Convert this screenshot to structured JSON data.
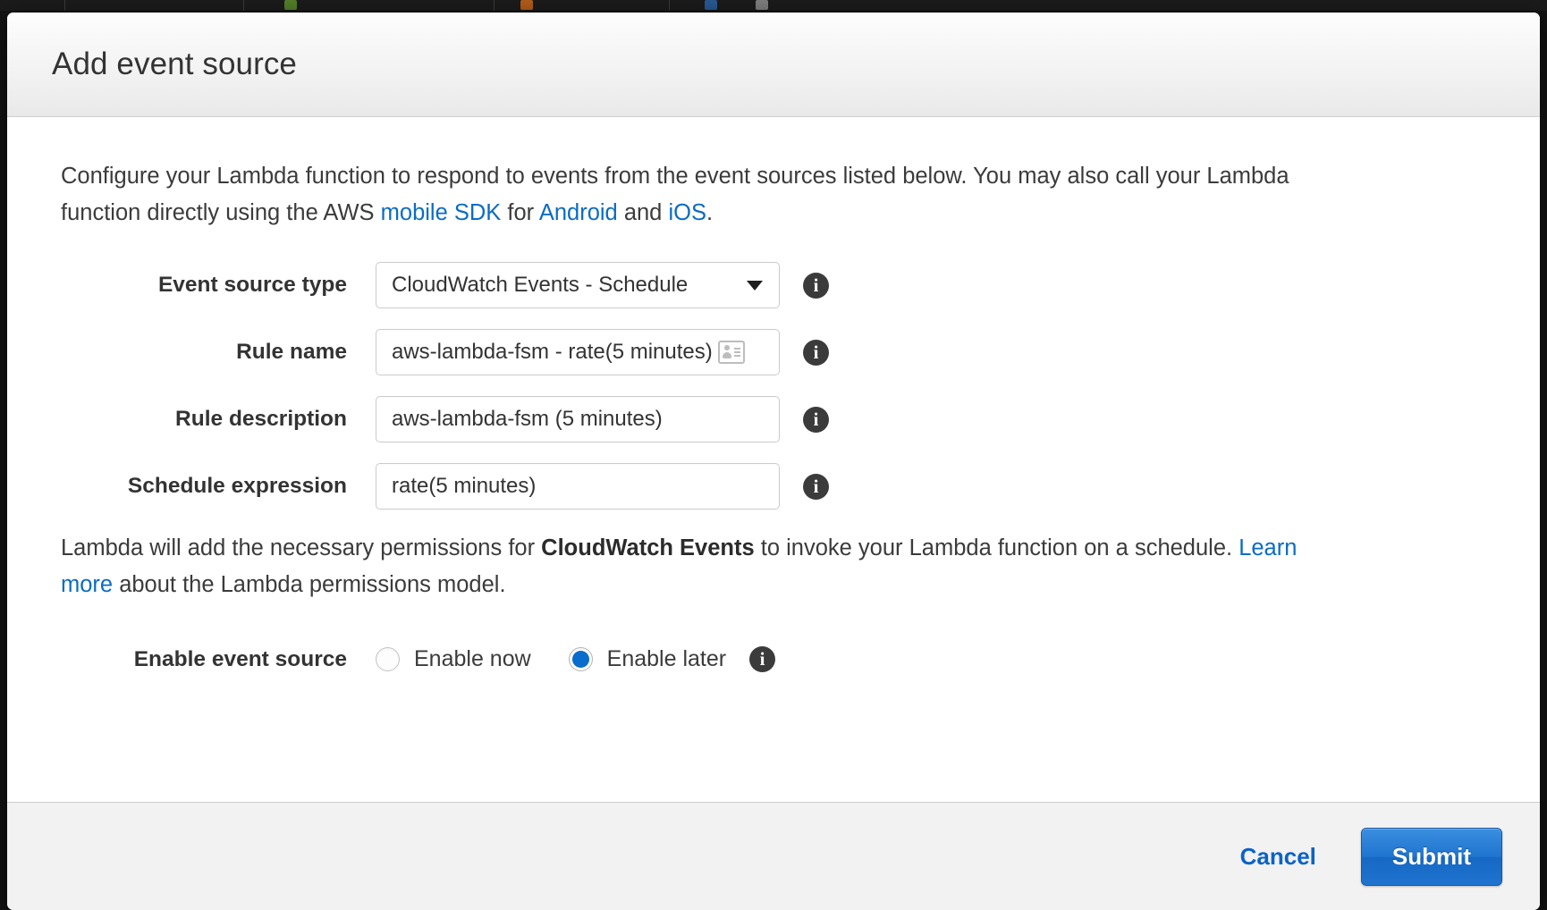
{
  "dialog": {
    "title": "Add event source",
    "intro": {
      "part1": "Configure your Lambda function to respond to events from the event sources listed below. You may also call your Lambda function directly using the AWS ",
      "link_mobile_sdk": "mobile SDK",
      "part2": " for ",
      "link_android": "Android",
      "part3": " and ",
      "link_ios": "iOS",
      "part4": "."
    },
    "fields": {
      "event_source_type": {
        "label": "Event source type",
        "value": "CloudWatch Events - Schedule",
        "caret_icon": "chevron-down-icon",
        "info_icon": "info-icon"
      },
      "rule_name": {
        "label": "Rule name",
        "value": "aws-lambda-fsm - rate(5 minutes)",
        "inline_icon": "id-card-icon",
        "info_icon": "info-icon"
      },
      "rule_description": {
        "label": "Rule description",
        "value": "aws-lambda-fsm (5 minutes)",
        "info_icon": "info-icon"
      },
      "schedule_expression": {
        "label": "Schedule expression",
        "value": "rate(5 minutes)",
        "info_icon": "info-icon"
      }
    },
    "permissions_note": {
      "part1": "Lambda will add the necessary permissions for ",
      "bold": "CloudWatch Events",
      "part2": " to invoke your Lambda function on a schedule. ",
      "link": "Learn more",
      "part3": " about the Lambda permissions model."
    },
    "enable_event_source": {
      "label": "Enable event source",
      "options": [
        {
          "label": "Enable now",
          "selected": false
        },
        {
          "label": "Enable later",
          "selected": true
        }
      ],
      "info_icon": "info-icon"
    },
    "footer": {
      "cancel_label": "Cancel",
      "submit_label": "Submit"
    },
    "info_glyph": "i",
    "colors": {
      "link": "#0a6cc4",
      "accent": "#1f74cf",
      "radio_selected": "#0a6ccc",
      "header_text": "#333333",
      "footer_bg": "#f2f2f2"
    }
  }
}
